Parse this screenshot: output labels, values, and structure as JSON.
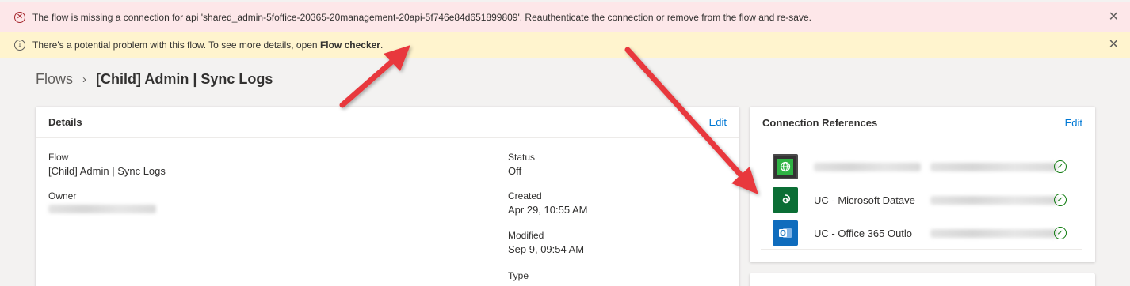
{
  "banners": {
    "error": {
      "icon": "error-circle-icon",
      "text": "The flow is missing a connection for api 'shared_admin-5foffice-20365-20management-20api-5f746e84d651899809'. Reauthenticate the connection or remove from the flow and re-save.",
      "color": "#fde7e9"
    },
    "warning": {
      "icon": "info-circle-icon",
      "text_prefix": "There's a potential problem with this flow. To see more details, open ",
      "link_text": "Flow checker",
      "text_suffix": ".",
      "color": "#fff4ce"
    }
  },
  "breadcrumb": {
    "root": "Flows",
    "current": "[Child] Admin | Sync Logs"
  },
  "details": {
    "title": "Details",
    "edit_label": "Edit",
    "flow_label": "Flow",
    "flow_value": "[Child] Admin | Sync Logs",
    "owner_label": "Owner",
    "status_label": "Status",
    "status_value": "Off",
    "created_label": "Created",
    "created_value": "Apr 29, 10:55 AM",
    "modified_label": "Modified",
    "modified_value": "Sep 9, 09:54 AM",
    "type_label": "Type"
  },
  "connection_references": {
    "title": "Connection References",
    "edit_label": "Edit",
    "items": [
      {
        "name": "",
        "icon": "globe-icon",
        "status": "check-circle-icon"
      },
      {
        "name": "UC - Microsoft Datave",
        "icon": "dataverse-icon",
        "status": "check-circle-icon"
      },
      {
        "name": "UC - Office 365 Outlo",
        "icon": "outlook-icon",
        "status": "check-circle-icon"
      }
    ]
  },
  "colors": {
    "accent": "#0078d4",
    "success": "#107c10",
    "annotation_arrow": "#e8383d"
  }
}
